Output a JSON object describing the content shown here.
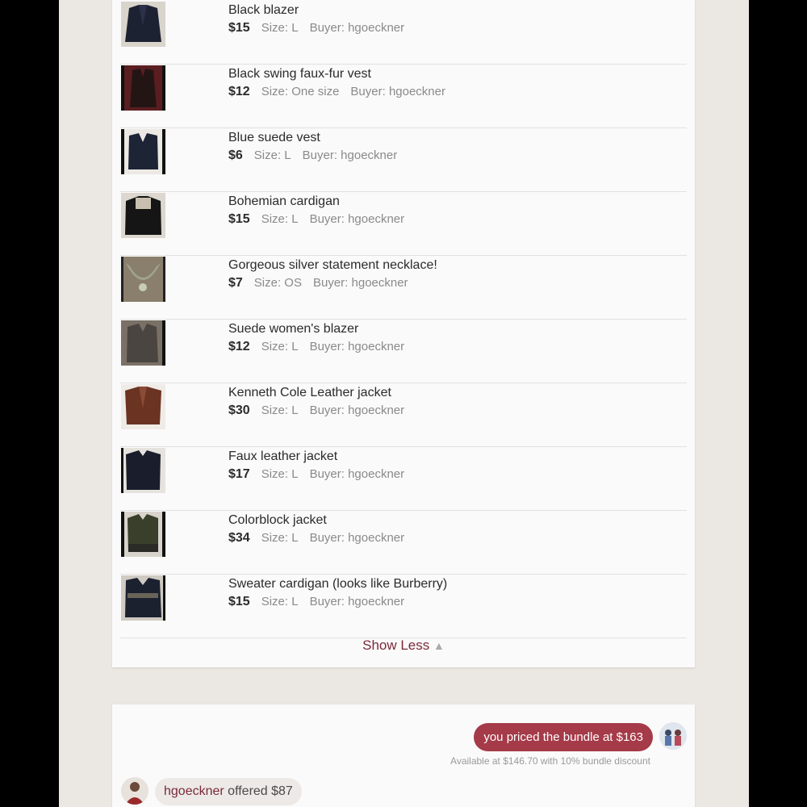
{
  "items": [
    {
      "title": "Black blazer",
      "price": "$15",
      "size": "Size: L",
      "buyer": "Buyer: hgoeckner",
      "thumb_icon": "black-blazer-photo"
    },
    {
      "title": "Black swing faux-fur vest",
      "price": "$12",
      "size": "Size: One size",
      "buyer": "Buyer: hgoeckner",
      "thumb_icon": "fur-vest-photo"
    },
    {
      "title": "Blue suede vest",
      "price": "$6",
      "size": "Size: L",
      "buyer": "Buyer: hgoeckner",
      "thumb_icon": "suede-vest-photo"
    },
    {
      "title": "Bohemian cardigan",
      "price": "$15",
      "size": "Size: L",
      "buyer": "Buyer: hgoeckner",
      "thumb_icon": "cardigan-photo"
    },
    {
      "title": "Gorgeous silver statement necklace!",
      "price": "$7",
      "size": "Size: OS",
      "buyer": "Buyer: hgoeckner",
      "thumb_icon": "necklace-photo"
    },
    {
      "title": "Suede women's blazer",
      "price": "$12",
      "size": "Size: L",
      "buyer": "Buyer: hgoeckner",
      "thumb_icon": "suede-blazer-photo"
    },
    {
      "title": "Kenneth Cole Leather jacket",
      "price": "$30",
      "size": "Size: L",
      "buyer": "Buyer: hgoeckner",
      "thumb_icon": "leather-jacket-photo"
    },
    {
      "title": "Faux leather jacket",
      "price": "$17",
      "size": "Size: L",
      "buyer": "Buyer: hgoeckner",
      "thumb_icon": "faux-leather-jacket-photo"
    },
    {
      "title": "Colorblock jacket",
      "price": "$34",
      "size": "Size: L",
      "buyer": "Buyer: hgoeckner",
      "thumb_icon": "colorblock-jacket-photo"
    },
    {
      "title": "Sweater cardigan (looks like Burberry)",
      "price": "$15",
      "size": "Size: L",
      "buyer": "Buyer: hgoeckner",
      "thumb_icon": "sweater-cardigan-photo"
    }
  ],
  "show_less_label": "Show Less",
  "conversation": {
    "my_message": "you priced the bundle at $163",
    "discount_note": "Available at $146.70 with 10% bundle discount",
    "offer_user": "hgoeckner",
    "offer_text": " offered $87"
  },
  "colors": {
    "accent": "#a53a48",
    "link": "#7a2a3a",
    "page_bg": "#ebe8e3",
    "card_bg": "#fbfafa"
  }
}
